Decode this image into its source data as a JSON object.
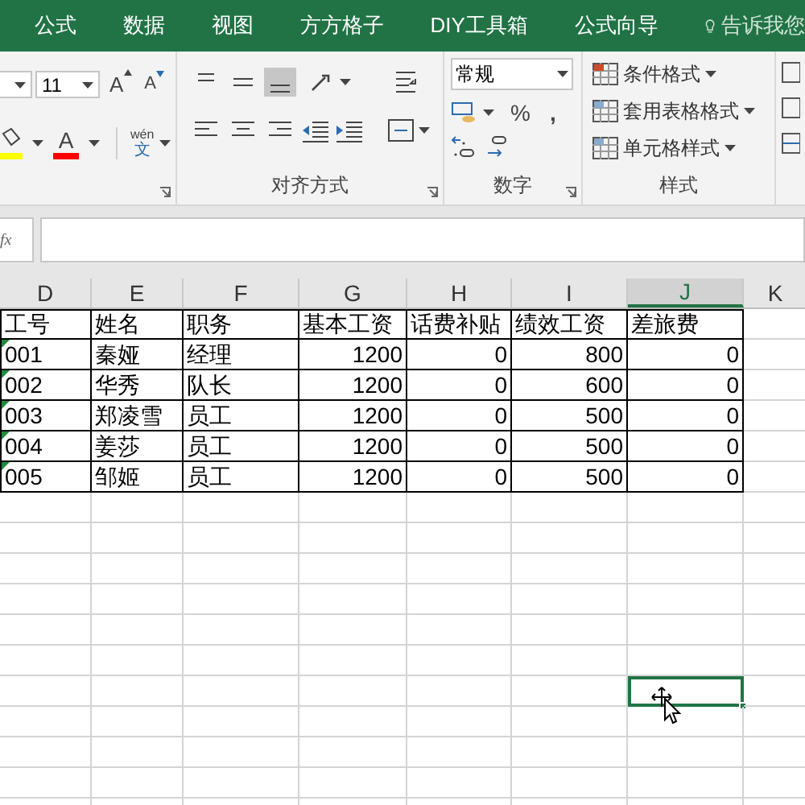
{
  "ribbon_tabs": [
    {
      "label": "公式"
    },
    {
      "label": "数据"
    },
    {
      "label": "视图"
    },
    {
      "label": "方方格子"
    },
    {
      "label": "DIY工具箱"
    },
    {
      "label": "公式向导"
    }
  ],
  "tell_me": "告诉我您",
  "font": {
    "size": "11",
    "grow": "A",
    "shrink": "A",
    "color_letter": "A",
    "phonetic_top": "wén",
    "phonetic_bottom": "文"
  },
  "alignment": {
    "label": "对齐方式"
  },
  "number": {
    "format": "常规",
    "percent": "%",
    "comma": ",",
    "label": "数字"
  },
  "styles": {
    "buttons": [
      "条件格式",
      "套用表格格式",
      "单元格样式"
    ],
    "label": "样式"
  },
  "formula_bar": {
    "fx": "fx"
  },
  "columns": [
    {
      "label": "D",
      "selected": false
    },
    {
      "label": "E",
      "selected": false
    },
    {
      "label": "F",
      "selected": false
    },
    {
      "label": "G",
      "selected": false
    },
    {
      "label": "H",
      "selected": false
    },
    {
      "label": "I",
      "selected": false
    },
    {
      "label": "J",
      "selected": true
    },
    {
      "label": "K",
      "selected": false
    }
  ],
  "table": {
    "header": [
      "工号",
      "姓名",
      "职务",
      "基本工资",
      "话费补贴",
      "绩效工资",
      "差旅费"
    ],
    "rows": [
      [
        "001",
        "秦娅",
        "经理",
        "1200",
        "0",
        "800",
        "0"
      ],
      [
        "002",
        "华秀",
        "队长",
        "1200",
        "0",
        "600",
        "0"
      ],
      [
        "003",
        "郑凌雪",
        "员工",
        "1200",
        "0",
        "500",
        "0"
      ],
      [
        "004",
        "姜莎",
        "员工",
        "1200",
        "0",
        "500",
        "0"
      ],
      [
        "005",
        "邹姬",
        "员工",
        "1200",
        "0",
        "500",
        "0"
      ]
    ]
  }
}
